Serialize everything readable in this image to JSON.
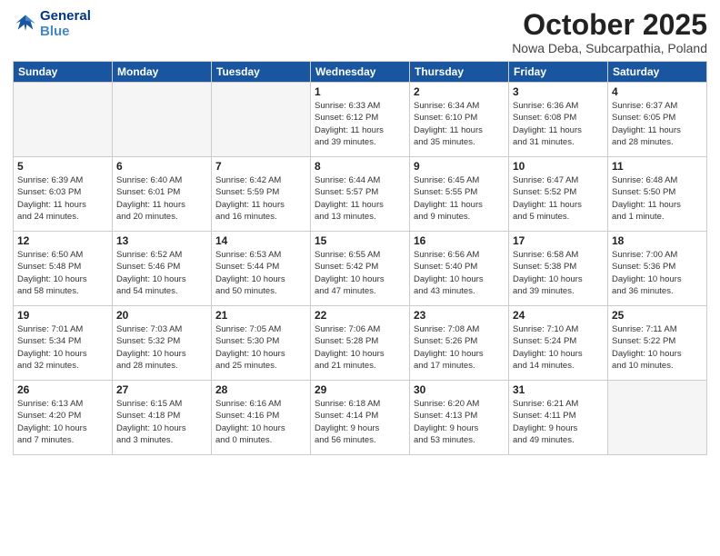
{
  "header": {
    "logo_line1": "General",
    "logo_line2": "Blue",
    "month": "October 2025",
    "location": "Nowa Deba, Subcarpathia, Poland"
  },
  "weekdays": [
    "Sunday",
    "Monday",
    "Tuesday",
    "Wednesday",
    "Thursday",
    "Friday",
    "Saturday"
  ],
  "weeks": [
    [
      {
        "day": "",
        "info": ""
      },
      {
        "day": "",
        "info": ""
      },
      {
        "day": "",
        "info": ""
      },
      {
        "day": "1",
        "info": "Sunrise: 6:33 AM\nSunset: 6:12 PM\nDaylight: 11 hours\nand 39 minutes."
      },
      {
        "day": "2",
        "info": "Sunrise: 6:34 AM\nSunset: 6:10 PM\nDaylight: 11 hours\nand 35 minutes."
      },
      {
        "day": "3",
        "info": "Sunrise: 6:36 AM\nSunset: 6:08 PM\nDaylight: 11 hours\nand 31 minutes."
      },
      {
        "day": "4",
        "info": "Sunrise: 6:37 AM\nSunset: 6:05 PM\nDaylight: 11 hours\nand 28 minutes."
      }
    ],
    [
      {
        "day": "5",
        "info": "Sunrise: 6:39 AM\nSunset: 6:03 PM\nDaylight: 11 hours\nand 24 minutes."
      },
      {
        "day": "6",
        "info": "Sunrise: 6:40 AM\nSunset: 6:01 PM\nDaylight: 11 hours\nand 20 minutes."
      },
      {
        "day": "7",
        "info": "Sunrise: 6:42 AM\nSunset: 5:59 PM\nDaylight: 11 hours\nand 16 minutes."
      },
      {
        "day": "8",
        "info": "Sunrise: 6:44 AM\nSunset: 5:57 PM\nDaylight: 11 hours\nand 13 minutes."
      },
      {
        "day": "9",
        "info": "Sunrise: 6:45 AM\nSunset: 5:55 PM\nDaylight: 11 hours\nand 9 minutes."
      },
      {
        "day": "10",
        "info": "Sunrise: 6:47 AM\nSunset: 5:52 PM\nDaylight: 11 hours\nand 5 minutes."
      },
      {
        "day": "11",
        "info": "Sunrise: 6:48 AM\nSunset: 5:50 PM\nDaylight: 11 hours\nand 1 minute."
      }
    ],
    [
      {
        "day": "12",
        "info": "Sunrise: 6:50 AM\nSunset: 5:48 PM\nDaylight: 10 hours\nand 58 minutes."
      },
      {
        "day": "13",
        "info": "Sunrise: 6:52 AM\nSunset: 5:46 PM\nDaylight: 10 hours\nand 54 minutes."
      },
      {
        "day": "14",
        "info": "Sunrise: 6:53 AM\nSunset: 5:44 PM\nDaylight: 10 hours\nand 50 minutes."
      },
      {
        "day": "15",
        "info": "Sunrise: 6:55 AM\nSunset: 5:42 PM\nDaylight: 10 hours\nand 47 minutes."
      },
      {
        "day": "16",
        "info": "Sunrise: 6:56 AM\nSunset: 5:40 PM\nDaylight: 10 hours\nand 43 minutes."
      },
      {
        "day": "17",
        "info": "Sunrise: 6:58 AM\nSunset: 5:38 PM\nDaylight: 10 hours\nand 39 minutes."
      },
      {
        "day": "18",
        "info": "Sunrise: 7:00 AM\nSunset: 5:36 PM\nDaylight: 10 hours\nand 36 minutes."
      }
    ],
    [
      {
        "day": "19",
        "info": "Sunrise: 7:01 AM\nSunset: 5:34 PM\nDaylight: 10 hours\nand 32 minutes."
      },
      {
        "day": "20",
        "info": "Sunrise: 7:03 AM\nSunset: 5:32 PM\nDaylight: 10 hours\nand 28 minutes."
      },
      {
        "day": "21",
        "info": "Sunrise: 7:05 AM\nSunset: 5:30 PM\nDaylight: 10 hours\nand 25 minutes."
      },
      {
        "day": "22",
        "info": "Sunrise: 7:06 AM\nSunset: 5:28 PM\nDaylight: 10 hours\nand 21 minutes."
      },
      {
        "day": "23",
        "info": "Sunrise: 7:08 AM\nSunset: 5:26 PM\nDaylight: 10 hours\nand 17 minutes."
      },
      {
        "day": "24",
        "info": "Sunrise: 7:10 AM\nSunset: 5:24 PM\nDaylight: 10 hours\nand 14 minutes."
      },
      {
        "day": "25",
        "info": "Sunrise: 7:11 AM\nSunset: 5:22 PM\nDaylight: 10 hours\nand 10 minutes."
      }
    ],
    [
      {
        "day": "26",
        "info": "Sunrise: 6:13 AM\nSunset: 4:20 PM\nDaylight: 10 hours\nand 7 minutes."
      },
      {
        "day": "27",
        "info": "Sunrise: 6:15 AM\nSunset: 4:18 PM\nDaylight: 10 hours\nand 3 minutes."
      },
      {
        "day": "28",
        "info": "Sunrise: 6:16 AM\nSunset: 4:16 PM\nDaylight: 10 hours\nand 0 minutes."
      },
      {
        "day": "29",
        "info": "Sunrise: 6:18 AM\nSunset: 4:14 PM\nDaylight: 9 hours\nand 56 minutes."
      },
      {
        "day": "30",
        "info": "Sunrise: 6:20 AM\nSunset: 4:13 PM\nDaylight: 9 hours\nand 53 minutes."
      },
      {
        "day": "31",
        "info": "Sunrise: 6:21 AM\nSunset: 4:11 PM\nDaylight: 9 hours\nand 49 minutes."
      },
      {
        "day": "",
        "info": ""
      }
    ]
  ]
}
